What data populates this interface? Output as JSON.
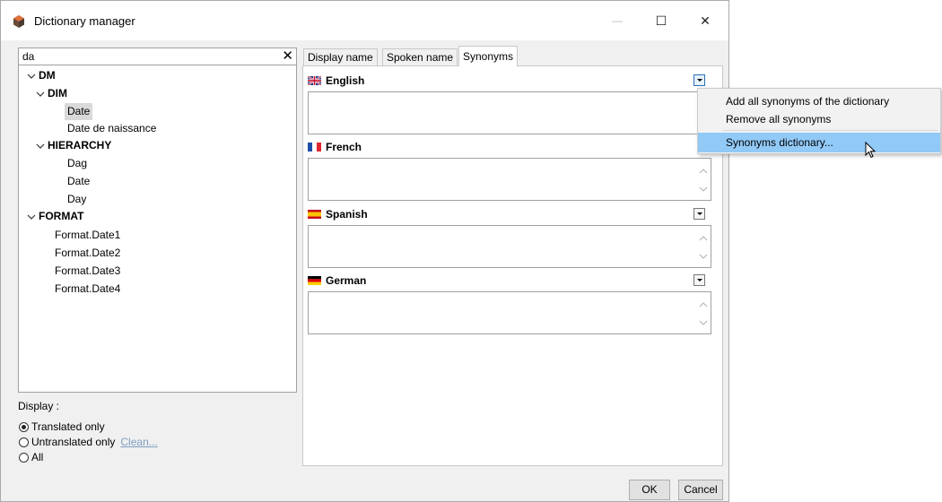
{
  "window": {
    "title": "Dictionary manager",
    "controls": {
      "minimize": "—",
      "maximize": "☐",
      "close": "✕"
    }
  },
  "search": {
    "value": "da",
    "clear_icon": "✕"
  },
  "tree": {
    "dm": "DM",
    "dim": "DIM",
    "dim_date": "Date",
    "dim_date_naissance": "Date de  naissance",
    "hierarchy": "HIERARCHY",
    "hier_dag": "Dag",
    "hier_date": "Date",
    "hier_day": "Day",
    "format": "FORMAT",
    "format_date1": "Format.Date1",
    "format_date2": "Format.Date2",
    "format_date3": "Format.Date3",
    "format_date4": "Format.Date4"
  },
  "display": {
    "label": "Display :",
    "options": [
      "Translated only",
      "Untranslated only",
      "All"
    ],
    "selected": "Translated only",
    "clean_link": "Clean..."
  },
  "tabs": [
    "Display name",
    "Spoken name",
    "Synonyms"
  ],
  "active_tab": "Synonyms",
  "languages": [
    "English",
    "French",
    "Spanish",
    "German"
  ],
  "context_menu": {
    "items": [
      "Add all synonyms of the dictionary",
      "Remove all synonyms",
      "Synonyms dictionary..."
    ],
    "highlighted": "Synonyms dictionary..."
  },
  "buttons": {
    "ok": "OK",
    "cancel": "Cancel"
  },
  "colors": {
    "window_bg": "#f0f0f0",
    "menu_highlight": "#91c9f7",
    "link": "#7f9fbf",
    "selection": "#d9d9d9"
  }
}
